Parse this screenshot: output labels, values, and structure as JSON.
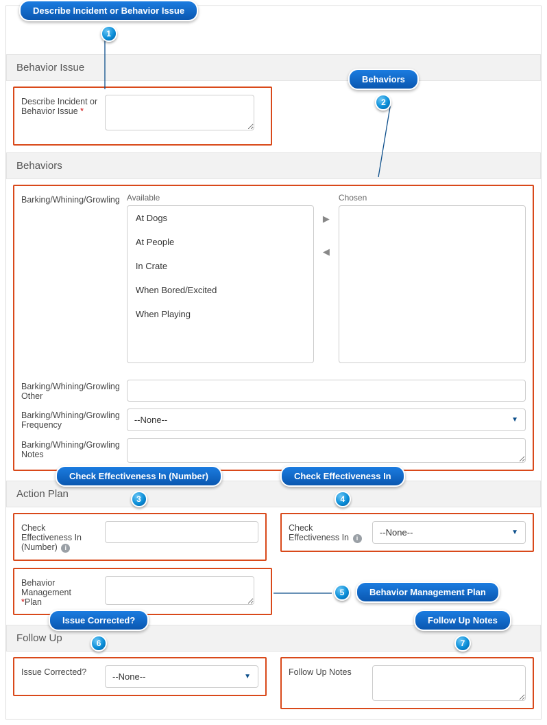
{
  "callouts": {
    "c1": "Describe Incident or Behavior Issue",
    "c2": "Behaviors",
    "c3": "Check Effectiveness In (Number)",
    "c4": "Check Effectiveness In",
    "c5": "Behavior Management Plan",
    "c6": "Issue Corrected?",
    "c7": "Follow Up Notes",
    "n1": "1",
    "n2": "2",
    "n3": "3",
    "n4": "4",
    "n5": "5",
    "n6": "6",
    "n7": "7"
  },
  "sections": {
    "behavior_issue": "Behavior Issue",
    "behaviors": "Behaviors",
    "action_plan": "Action Plan",
    "follow_up": "Follow Up"
  },
  "behavior_issue": {
    "describe_label": "Describe Incident or Behavior Issue"
  },
  "behaviors": {
    "bwg_label": "Barking/Whining/Growling",
    "available_label": "Available",
    "chosen_label": "Chosen",
    "options": [
      "At Dogs",
      "At People",
      "In Crate",
      "When Bored/Excited",
      "When Playing"
    ],
    "other_label": "Barking/Whining/Growling Other",
    "freq_label": "Barking/Whining/Growling Frequency",
    "freq_value": "--None--",
    "notes_label": "Barking/Whining/Growling Notes"
  },
  "action_plan": {
    "check_num_label": "Check Effectiveness In (Number)",
    "check_label": "Check Effectiveness In",
    "check_value": "--None--",
    "bmp_label_1": "Behavior Management",
    "bmp_label_2": "Plan"
  },
  "follow_up": {
    "issue_label": "Issue Corrected?",
    "issue_value": "--None--",
    "notes_label": "Follow Up Notes"
  }
}
